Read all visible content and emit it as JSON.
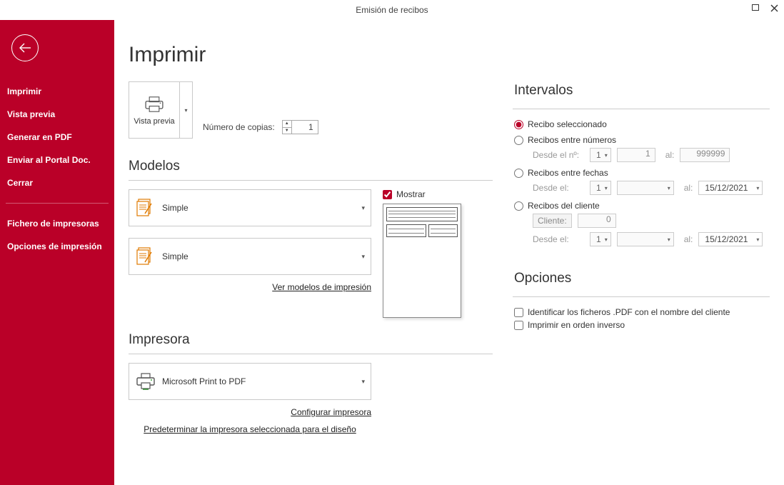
{
  "window": {
    "title": "Emisión de recibos"
  },
  "sidebar": {
    "items": [
      {
        "label": "Imprimir"
      },
      {
        "label": "Vista previa"
      },
      {
        "label": "Generar en PDF"
      },
      {
        "label": "Enviar al Portal Doc."
      },
      {
        "label": "Cerrar"
      }
    ],
    "items2": [
      {
        "label": "Fichero de impresoras"
      },
      {
        "label": "Opciones de impresión"
      }
    ]
  },
  "page": {
    "title": "Imprimir",
    "preview_btn_label": "Vista previa",
    "copies_label": "Número de copias:",
    "copies_value": "1",
    "section_models": "Modelos",
    "model1_label": "Simple",
    "model2_label": "Simple",
    "mostrar_label": "Mostrar",
    "link_models": "Ver modelos de impresión",
    "section_printer": "Impresora",
    "printer_label": "Microsoft Print to PDF",
    "link_configure": "Configurar impresora",
    "link_default": "Predeterminar la impresora seleccionada para el diseño"
  },
  "intervals": {
    "heading": "Intervalos",
    "r1": "Recibo seleccionado",
    "r2": "Recibos entre números",
    "r2_from_label": "Desde el nº:",
    "r2_from_combo": "1",
    "r2_from_input": "1",
    "r2_to_label": "al:",
    "r2_to_input": "999999",
    "r3": "Recibos entre fechas",
    "r3_from_label": "Desde el:",
    "r3_from_combo": "1",
    "r3_to_label": "al:",
    "r3_to_date": "15/12/2021",
    "r4": "Recibos del cliente",
    "r4_client_label": "Cliente:",
    "r4_client_value": "0",
    "r4_from_label": "Desde el:",
    "r4_from_combo": "1",
    "r4_to_label": "al:",
    "r4_to_date": "15/12/2021"
  },
  "options": {
    "heading": "Opciones",
    "chk1": "Identificar los ficheros .PDF con el nombre del cliente",
    "chk2": "Imprimir en orden inverso"
  }
}
